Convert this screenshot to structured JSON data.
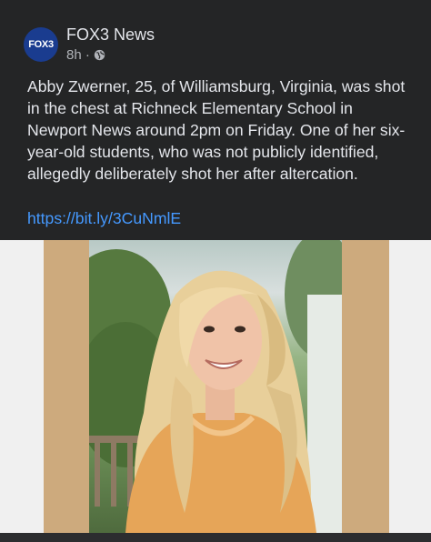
{
  "page": {
    "name": "FOX3 News",
    "avatar_text": "FOX3",
    "time": "8h ·",
    "audience_icon": "globe-icon"
  },
  "post": {
    "text": "Abby Zwerner, 25, of Williamsburg, Virginia, was shot in the chest at Richneck Elementary School in Newport News around 2pm on Friday. One of her six-year-old students, who was not publicly identified, allegedly deliberately shot her after altercation.",
    "link": "https://bit.ly/3CuNmlE"
  },
  "colors": {
    "background": "#242526",
    "text": "#e4e6eb",
    "link": "#4599ff",
    "avatar": "#1a3c8f",
    "frame": "#cdaa7d"
  }
}
